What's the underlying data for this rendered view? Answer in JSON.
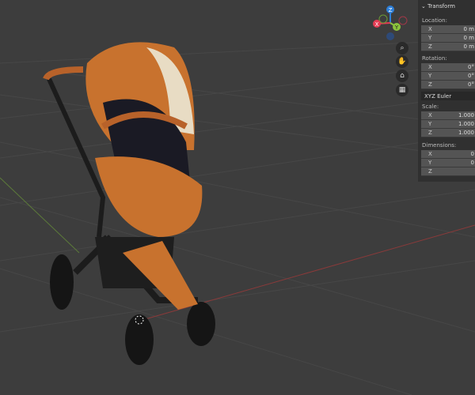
{
  "panel": {
    "title": "Transform",
    "location": {
      "label": "Location:",
      "x": "0 m",
      "y": "0 m",
      "z": "0 m"
    },
    "rotation": {
      "label": "Rotation:",
      "x": "0°",
      "y": "0°",
      "z": "0°",
      "mode": "XYZ Euler"
    },
    "scale": {
      "label": "Scale:",
      "x": "1.000",
      "y": "1.000",
      "z": "1.000"
    },
    "dimensions": {
      "label": "Dimensions:",
      "x": "0",
      "y": "0",
      "z": ""
    },
    "axes": {
      "x": "X",
      "y": "Y",
      "z": "Z"
    }
  },
  "gizmo": {
    "x": "X",
    "y": "Y",
    "z": "Z",
    "colors": {
      "x": "#e43c54",
      "y": "#8cc43c",
      "z": "#2e7fd8"
    }
  },
  "nav_icons": [
    "zoom-icon",
    "hand-icon",
    "camera-icon",
    "grid-icon"
  ],
  "accent": "#c8722e"
}
